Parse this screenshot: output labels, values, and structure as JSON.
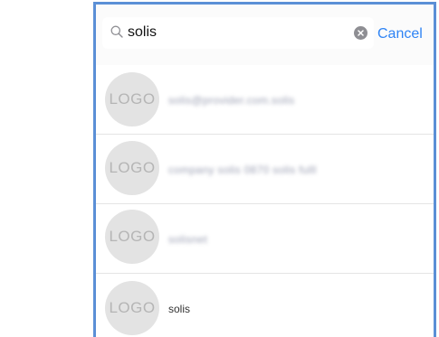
{
  "search": {
    "value": "solis",
    "cancel_label": "Cancel"
  },
  "results": [
    {
      "logo_text": "LOGO",
      "name": "solis@provider.com.solis"
    },
    {
      "logo_text": "LOGO",
      "name": "company solis 0870 solis fulll"
    },
    {
      "logo_text": "LOGO",
      "name": "solisnet"
    },
    {
      "logo_text": "LOGO",
      "name": "solis"
    }
  ],
  "colors": {
    "frame_border": "#5b8fd6",
    "accent": "#2f84f5",
    "avatar_bg": "#e3e3e3",
    "avatar_text": "#b5b5b5"
  }
}
